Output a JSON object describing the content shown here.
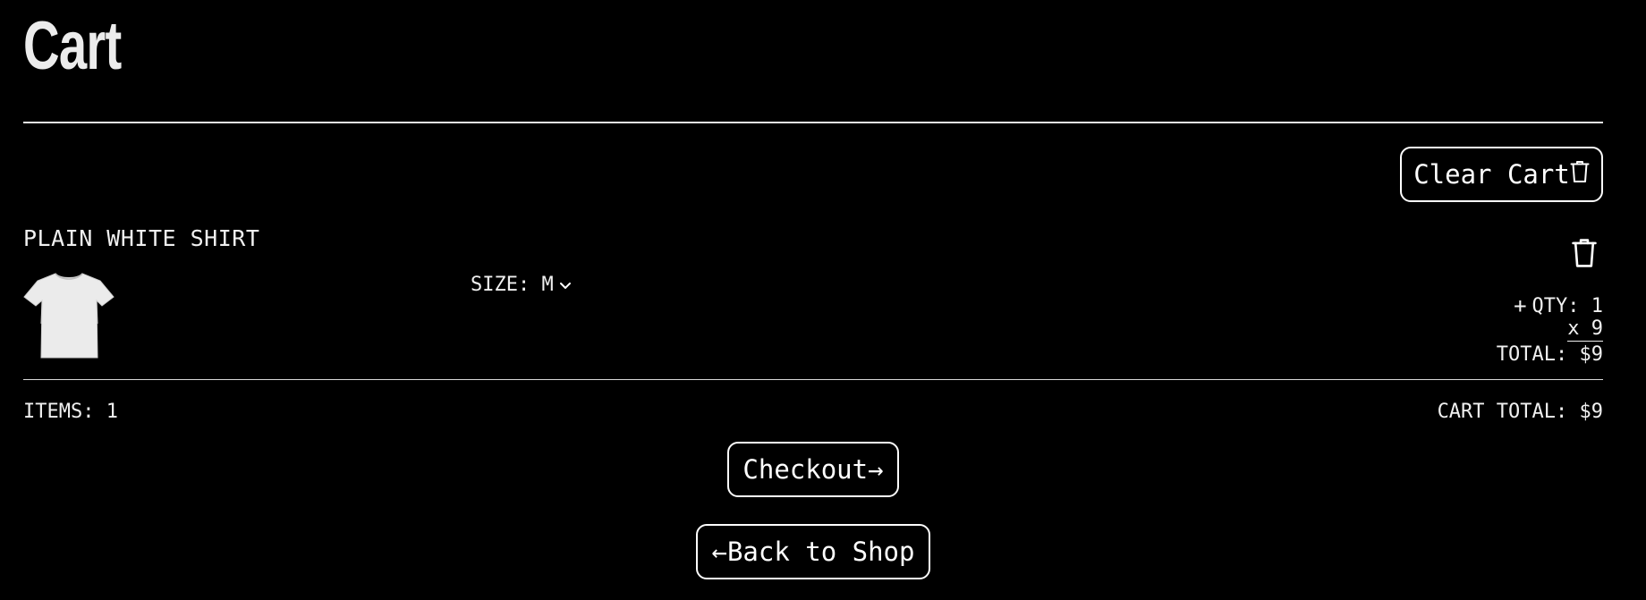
{
  "page": {
    "title": "Cart"
  },
  "cart": {
    "clear_label": "Clear Cart",
    "items": [
      {
        "name": "PLAIN WHITE SHIRT",
        "size_label": "SIZE: M",
        "plus": "+",
        "qty_label": "QTY: 1",
        "price_label": "x 9",
        "total_label": "TOTAL: $9"
      }
    ],
    "summary": {
      "items_label": "ITEMS: 1",
      "total_label": "CART TOTAL: $9"
    },
    "checkout_label": "Checkout→",
    "back_label": "←Back to Shop"
  },
  "icons": {
    "trash": "trash-icon",
    "chevron": "chevron-down-icon",
    "product": "shirt-image"
  },
  "colors": {
    "background": "#000000",
    "foreground": "#ffffff"
  }
}
